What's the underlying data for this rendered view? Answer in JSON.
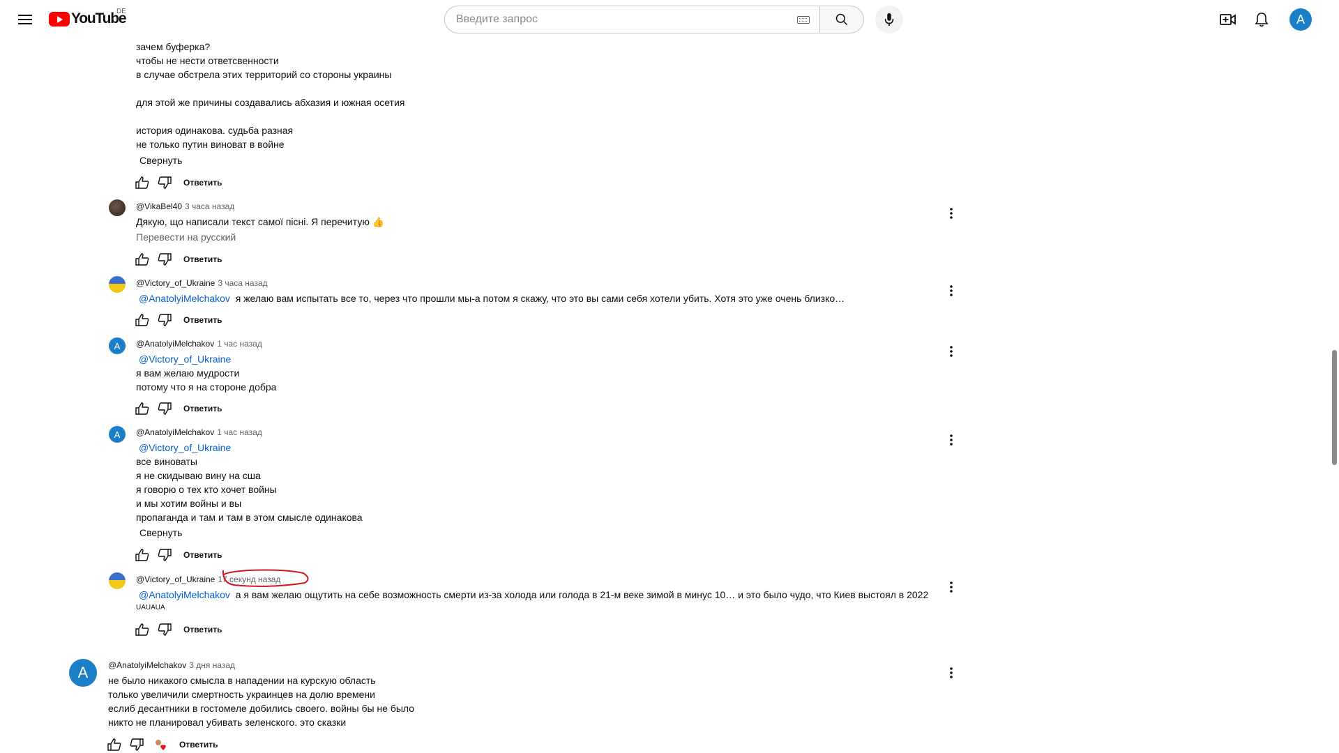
{
  "header": {
    "logo_text": "YouTube",
    "logo_country": "DE",
    "search_placeholder": "Введите запрос",
    "avatar_letter": "A"
  },
  "thread_top": {
    "lines": [
      "зачем буферка?",
      "чтобы не нести ответсвенности",
      "в случае обстрела этих территорий со стороны украины",
      "",
      "для этой же причины создавались абхазия и южная осетия",
      "",
      "история одинакова. судьба разная",
      "не только путин виноват в войне"
    ],
    "collapse_label": "Свернуть",
    "reply_label": "Ответить"
  },
  "replies": [
    {
      "author": "@VikaBel40",
      "time": "3 часа назад",
      "text": "Дякую, що написали текст самої пісні. Я перечитую 👍",
      "translate": "Перевести на русский",
      "reply_label": "Ответить"
    },
    {
      "author": "@Victory_of_Ukraine",
      "time": "3 часа назад",
      "mention": "@AnatolyiMelchakov",
      "text": "я желаю вам испытать все то, через что прошли мы-а потом я скажу, что это вы сами себя хотели убить. Хотя это уже очень близко…",
      "reply_label": "Ответить"
    },
    {
      "author": "@AnatolyiMelchakov",
      "time": "1 час назад",
      "avatar_letter": "A",
      "mention": "@Victory_of_Ukraine",
      "lines": [
        "я вам желаю мудрости",
        "потому что я на стороне добра"
      ],
      "reply_label": "Ответить"
    },
    {
      "author": "@AnatolyiMelchakov",
      "time": "1 час назад",
      "avatar_letter": "A",
      "mention": "@Victory_of_Ukraine",
      "lines": [
        "все виноваты",
        "я не скидываю вину на сша",
        "я говорю о тех кто хочет войны",
        "и мы хотим войны и вы",
        "пропаганда и там и там в этом смысле одинакова"
      ],
      "collapse_label": "Свернуть",
      "reply_label": "Ответить"
    },
    {
      "author": "@Victory_of_Ukraine",
      "time": "17 секунд назад",
      "mention": "@AnatolyiMelchakov",
      "text": "а я вам желаю ощутить на себе возможность смерти из-за холода или голода в 21-м веке зимой в минус 10… и это было чудо, что Киев выстоял в 2022",
      "extra": "UAUAUA",
      "reply_label": "Ответить"
    }
  ],
  "top_comment": {
    "author": "@AnatolyiMelchakov",
    "time": "3 дня назад",
    "avatar_letter": "A",
    "lines": [
      "не было никакого смысла в нападении на курскую область",
      "только увеличили смертность украинцев на долю времени",
      "еслиб десантники в гостомеле добились своего. войны бы не было",
      "никто не планировал убивать зеленского. это сказки"
    ],
    "reply_label": "Ответить"
  },
  "colors": {
    "accent_red": "#ff0000",
    "link_blue": "#065fd4",
    "avatar_blue": "#1a7fc7",
    "annotation_red": "#d4141c"
  }
}
